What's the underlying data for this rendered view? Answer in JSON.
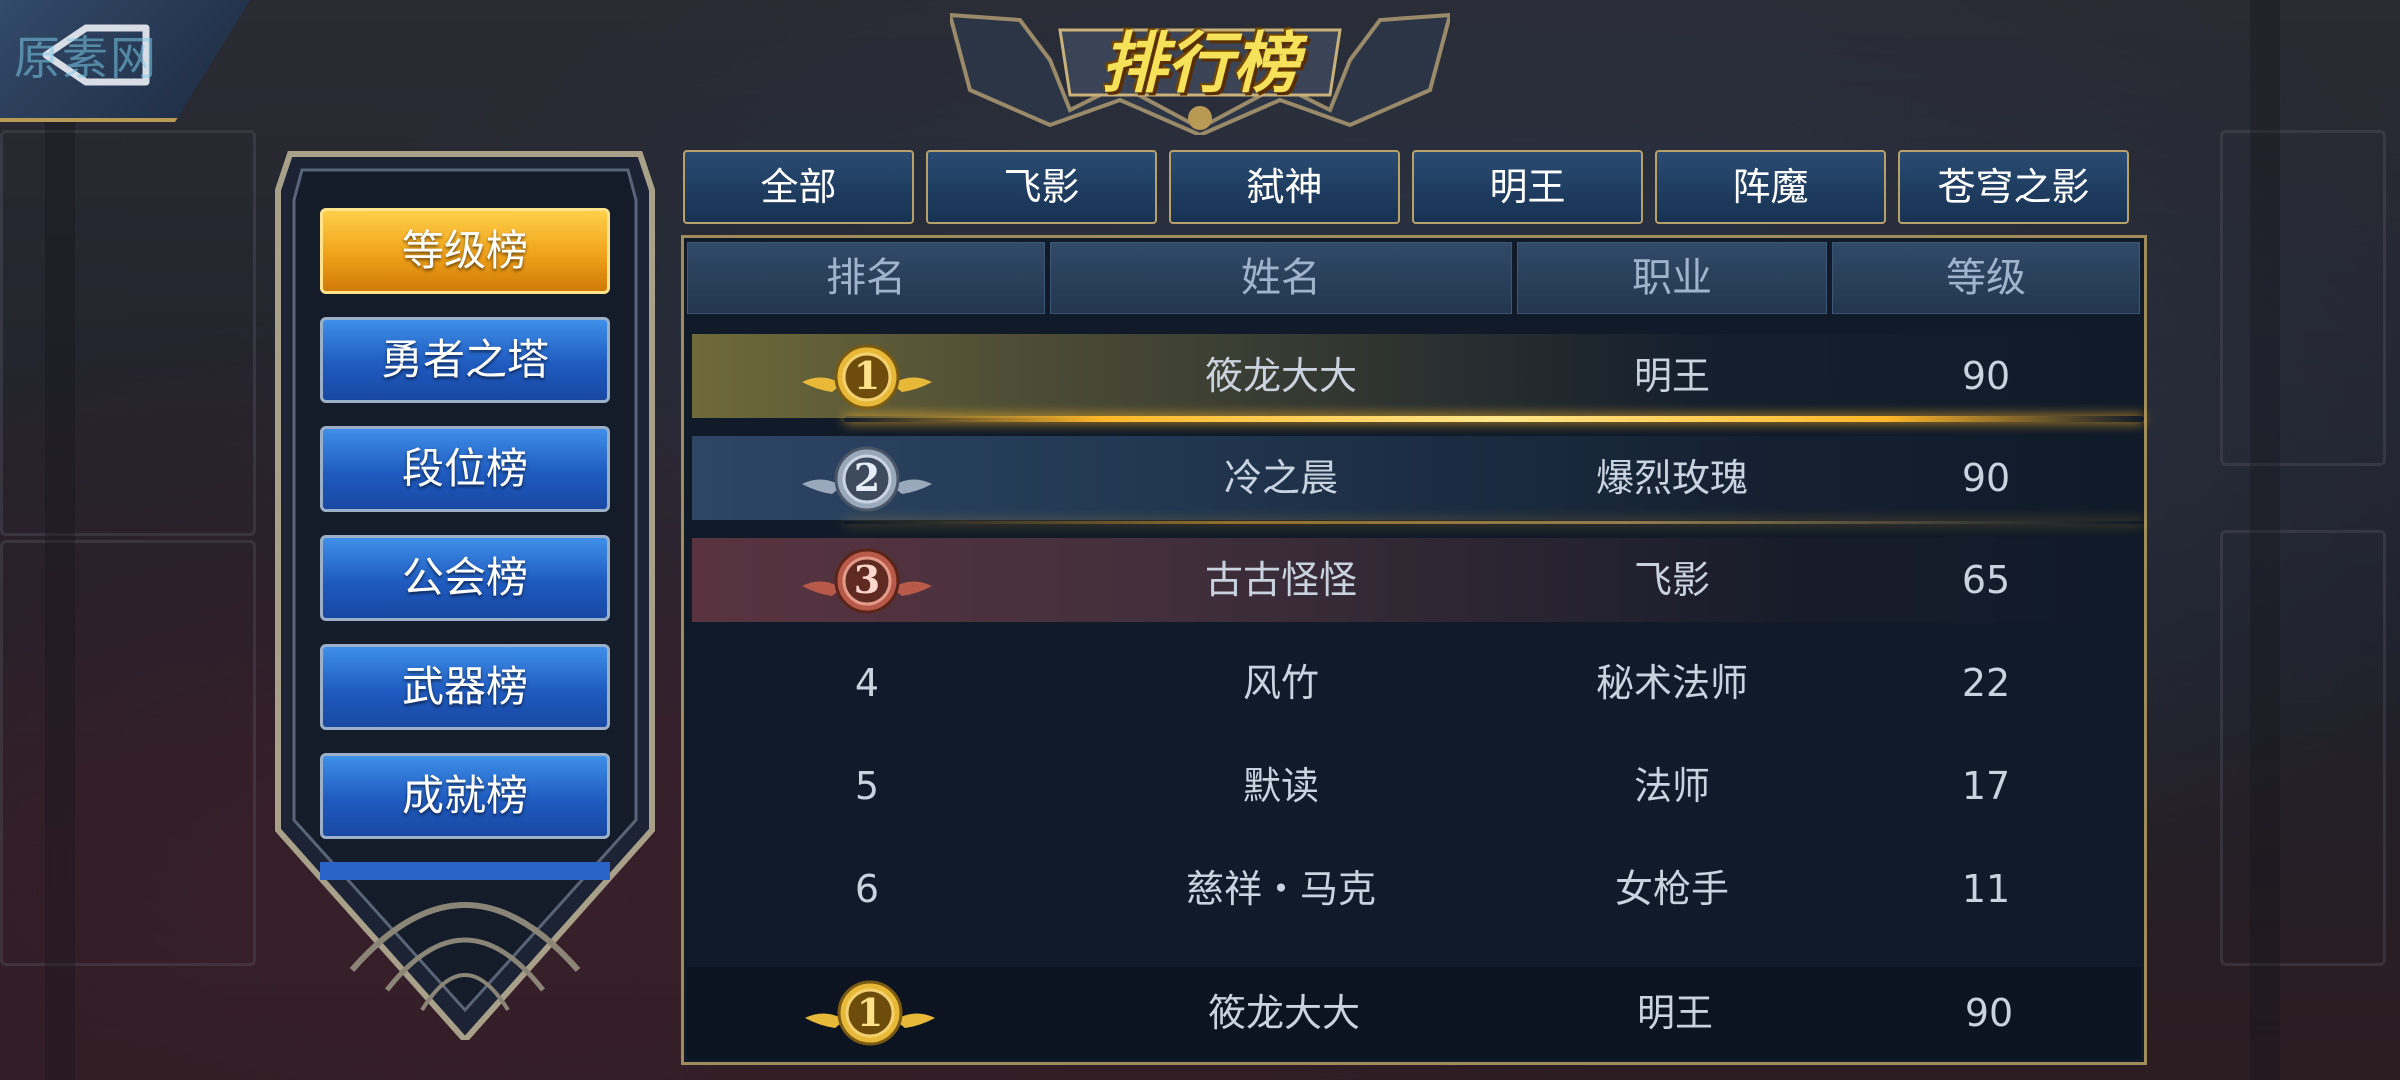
{
  "watermark": "原素网",
  "title": "排行榜",
  "left_menu": [
    {
      "label": "等级榜",
      "active": true
    },
    {
      "label": "勇者之塔",
      "active": false
    },
    {
      "label": "段位榜",
      "active": false
    },
    {
      "label": "公会榜",
      "active": false
    },
    {
      "label": "武器榜",
      "active": false
    },
    {
      "label": "成就榜",
      "active": false
    }
  ],
  "tabs": [
    "全部",
    "飞影",
    "弑神",
    "明王",
    "阵魔",
    "苍穹之影"
  ],
  "columns": [
    "排名",
    "姓名",
    "职业",
    "等级"
  ],
  "rows": [
    {
      "rank": "1",
      "name": "筱龙大大",
      "job": "明王",
      "level": "90"
    },
    {
      "rank": "2",
      "name": "冷之晨",
      "job": "爆烈玫瑰",
      "level": "90"
    },
    {
      "rank": "3",
      "name": "古古怪怪",
      "job": "飞影",
      "level": "65"
    },
    {
      "rank": "4",
      "name": "风竹",
      "job": "秘术法师",
      "level": "22"
    },
    {
      "rank": "5",
      "name": "默读",
      "job": "法师",
      "level": "17"
    },
    {
      "rank": "6",
      "name": "慈祥・马克",
      "job": "女枪手",
      "level": "11"
    }
  ],
  "my_rank": {
    "rank": "1",
    "name": "筱龙大大",
    "job": "明王",
    "level": "90"
  },
  "colors": {
    "gold": "#e8b838",
    "silver": "#9aa8bc",
    "bronze": "#b85a4a",
    "active_tab": "#f0a21a"
  }
}
